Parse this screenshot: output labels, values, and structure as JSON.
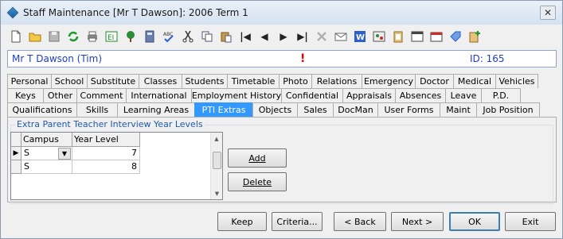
{
  "window": {
    "title": "Staff Maintenance  [Mr T Dawson]:  2006 Term 1",
    "close_glyph": "✕"
  },
  "toolbar": {
    "icons": [
      "new-doc-icon",
      "open-folder-icon",
      "save-icon",
      "refresh-icon",
      "print-icon",
      "edit-icon",
      "tree-icon",
      "calculator-icon",
      "spellcheck-icon",
      "cut-icon",
      "copy-icon",
      "paste-icon",
      "first-record-icon",
      "prev-record-icon",
      "next-record-icon",
      "last-record-icon",
      "delete-icon",
      "email-icon",
      "word-icon",
      "photo-icon",
      "clipboard-icon",
      "calendar-icon",
      "schedule-icon",
      "tag-icon",
      "add-note-icon"
    ]
  },
  "info": {
    "name": "Mr T Dawson (Tim)",
    "alert": "!",
    "id": "ID: 165"
  },
  "tabs": {
    "row1": [
      "Personal",
      "School",
      "Substitute",
      "Classes",
      "Students",
      "Timetable",
      "Photo",
      "Relations",
      "Emergency",
      "Doctor",
      "Medical",
      "Vehicles"
    ],
    "row2": [
      "Keys",
      "Other",
      "Comment",
      "International",
      "Employment History",
      "Confidential",
      "Appraisals",
      "Absences",
      "Leave",
      "P.D."
    ],
    "row3": [
      "Qualifications",
      "Skills",
      "Learning Areas",
      "PTI Extras",
      "Objects",
      "Sales",
      "DocMan",
      "User Forms",
      "Maint",
      "Job Position"
    ],
    "active": "PTI Extras"
  },
  "group": {
    "title": "Extra Parent Teacher Interview Year Levels"
  },
  "grid": {
    "columns": [
      "Campus",
      "Year Level"
    ],
    "rows": [
      {
        "campus": "S",
        "year_level": "7"
      },
      {
        "campus": "S",
        "year_level": "8"
      }
    ]
  },
  "side_buttons": {
    "add": "Add",
    "delete": "Delete"
  },
  "bottom_buttons": {
    "keep": "Keep",
    "criteria": "Criteria...",
    "back": "< Back",
    "next": "Next >",
    "ok": "OK",
    "exit": "Exit"
  }
}
